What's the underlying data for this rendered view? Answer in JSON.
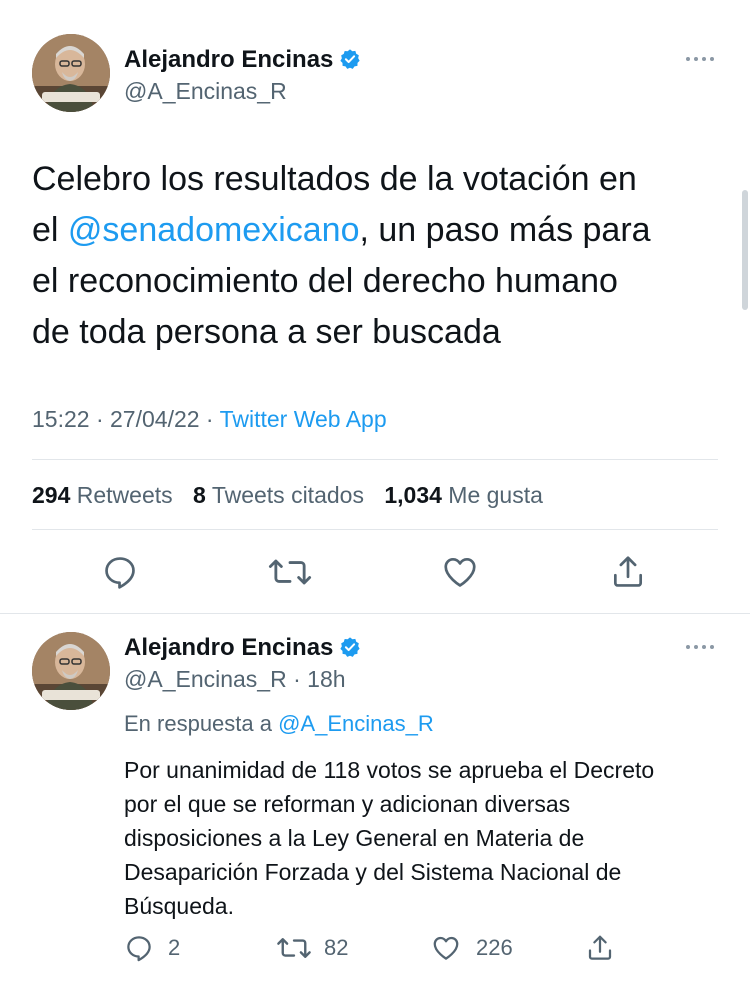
{
  "main_tweet": {
    "author": {
      "name": "Alejandro Encinas",
      "handle": "@A_Encinas_R"
    },
    "text_line1": "Celebro los resultados de la votación en",
    "text_pre": "el ",
    "mention": "@senadomexicano",
    "text_post": ", un paso más para",
    "text_line3": "el reconocimiento del derecho humano",
    "text_line4": "de toda persona a ser buscada",
    "time": "15:22",
    "date": "27/04/22",
    "source": "Twitter Web App",
    "stats": {
      "retweets_count": "294",
      "retweets_label": "Retweets",
      "quotes_count": "8",
      "quotes_label": "Tweets citados",
      "likes_count": "1,034",
      "likes_label": "Me gusta"
    }
  },
  "reply_tweet": {
    "author": {
      "name": "Alejandro Encinas",
      "handle": "@A_Encinas_R",
      "time": "18h"
    },
    "in_reply_label": "En respuesta a",
    "in_reply_handle": "@A_Encinas_R",
    "text_lines": [
      "Por unanimidad de 118 votos se aprueba el Decreto",
      "por el que se reforman y adicionan diversas",
      "disposiciones a la Ley General en Materia de",
      "Desaparición Forzada y del Sistema Nacional de",
      "Búsqueda."
    ],
    "counts": {
      "replies": "2",
      "retweets": "82",
      "likes": "226"
    }
  },
  "colors": {
    "accent": "#1d9bf0",
    "text": "#0f1419",
    "secondary": "#536471",
    "divider": "#e2e6ea"
  },
  "icons": [
    "verified-badge-icon",
    "more-icon",
    "reply-icon",
    "retweet-icon",
    "like-icon",
    "share-icon"
  ]
}
